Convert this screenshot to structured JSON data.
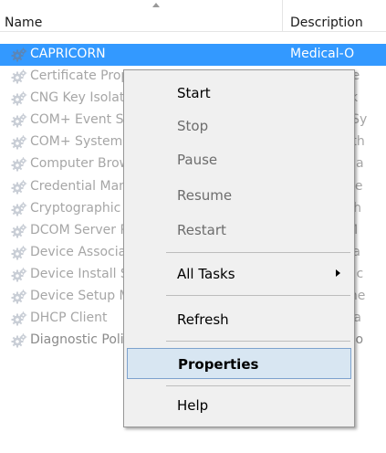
{
  "header": {
    "name": "Name",
    "description": "Description"
  },
  "rows": [
    {
      "name": "CAPRICORN",
      "desc": "Medical-O",
      "state": "selected"
    },
    {
      "name": "Certificate Propagation",
      "desc": "Copies use"
    },
    {
      "name": "CNG Key Isolation",
      "desc": "The CNG k"
    },
    {
      "name": "COM+ Event System",
      "desc": "Supports Sy"
    },
    {
      "name": "COM+ System Application",
      "desc": "Manages th"
    },
    {
      "name": "Computer Browser",
      "desc": "Maintains a"
    },
    {
      "name": "Credential Manager",
      "desc": "Provides se"
    },
    {
      "name": "Cryptographic Services",
      "desc": "Provides th"
    },
    {
      "name": "DCOM Server Process Launcher",
      "desc": "The DCOM"
    },
    {
      "name": "Device Association Service",
      "desc": "Enables pa"
    },
    {
      "name": "Device Install Service",
      "desc": "Enables a c"
    },
    {
      "name": "Device Setup Manager",
      "desc": "Enables the"
    },
    {
      "name": "DHCP Client",
      "desc": "Registers a"
    },
    {
      "name": "Diagnostic Policy Service",
      "desc": "The Diagno",
      "state": "dark"
    }
  ],
  "context_menu": {
    "start": "Start",
    "stop": "Stop",
    "pause": "Pause",
    "resume": "Resume",
    "restart": "Restart",
    "all_tasks": "All Tasks",
    "refresh": "Refresh",
    "properties": "Properties",
    "help": "Help"
  },
  "colors": {
    "selection": "#3399ff",
    "menu_hover": "#d8e6f2",
    "icon": "gear-service-icon"
  }
}
